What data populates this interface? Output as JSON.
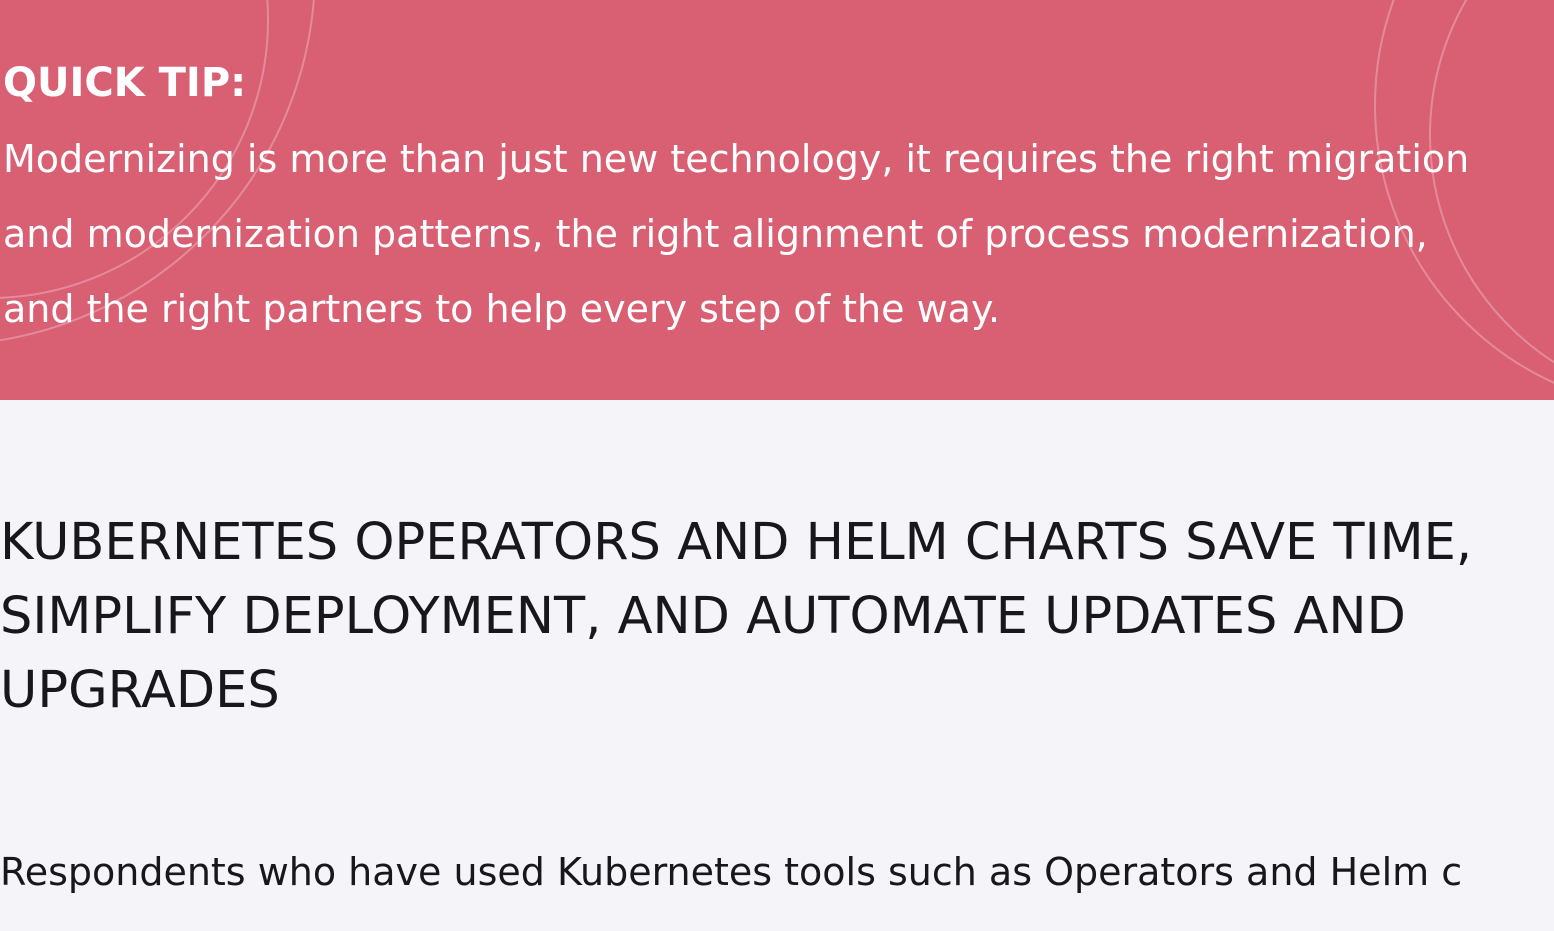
{
  "quick_tip": {
    "label": "QUICK TIP:",
    "lines": [
      " Modernizing is more than just new technology, it requires the right migration",
      "and modernization patterns, the right alignment of process modernization,",
      "and the right partners to help every step of the way."
    ]
  },
  "section": {
    "heading_lines": [
      "KUBERNETES OPERATORS AND HELM CHARTS SAVE TIME,",
      "SIMPLIFY DEPLOYMENT, AND AUTOMATE UPDATES AND",
      "UPGRADES"
    ],
    "body_lines": [
      "Respondents who have used Kubernetes tools such as Operators and Helm c"
    ]
  },
  "colors": {
    "banner_background": "#d95f73",
    "page_background": "#f5f4f9",
    "heading_text": "#17171c",
    "banner_text": "#ffffff"
  }
}
